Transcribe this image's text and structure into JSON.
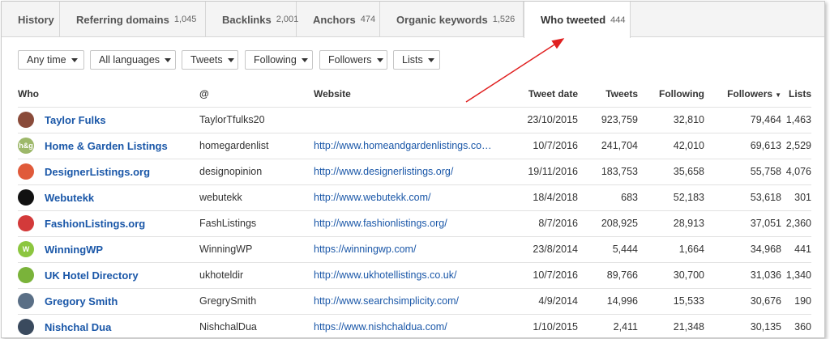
{
  "tabs": [
    {
      "label": "History",
      "count": ""
    },
    {
      "label": "Referring domains",
      "count": "1,045"
    },
    {
      "label": "Backlinks",
      "count": "2,001"
    },
    {
      "label": "Anchors",
      "count": "474"
    },
    {
      "label": "Organic keywords",
      "count": "1,526"
    },
    {
      "label": "Who tweeted",
      "count": "444"
    }
  ],
  "filters": [
    "Any time",
    "All languages",
    "Tweets",
    "Following",
    "Followers",
    "Lists"
  ],
  "table": {
    "headers": {
      "who": "Who",
      "at": "@",
      "website": "Website",
      "tweet_date": "Tweet date",
      "tweets": "Tweets",
      "following": "Following",
      "followers": "Followers",
      "lists": "Lists",
      "sort_indicator": "▼"
    },
    "rows": [
      {
        "name": "Taylor Fulks",
        "handle": "TaylorTfulks20",
        "website": "",
        "date": "23/10/2015",
        "tweets": "923,759",
        "following": "32,810",
        "followers": "79,464",
        "lists": "1,463",
        "avatar_color": "#8a4b3a",
        "avatar_text": ""
      },
      {
        "name": "Home & Garden Listings",
        "handle": "homegardenlist",
        "website": "http://www.homeandgardenlistings.co…",
        "date": "10/7/2016",
        "tweets": "241,704",
        "following": "42,010",
        "followers": "69,613",
        "lists": "2,529",
        "avatar_color": "#9db86a",
        "avatar_text": "h&g"
      },
      {
        "name": "DesignerListings.org",
        "handle": "designopinion",
        "website": "http://www.designerlistings.org/",
        "date": "19/11/2016",
        "tweets": "183,753",
        "following": "35,658",
        "followers": "55,758",
        "lists": "4,076",
        "avatar_color": "#e05a3a",
        "avatar_text": ""
      },
      {
        "name": "Webutekk",
        "handle": "webutekk",
        "website": "http://www.webutekk.com/",
        "date": "18/4/2018",
        "tweets": "683",
        "following": "52,183",
        "followers": "53,618",
        "lists": "301",
        "avatar_color": "#111111",
        "avatar_text": ""
      },
      {
        "name": "FashionListings.org",
        "handle": "FashListings",
        "website": "http://www.fashionlistings.org/",
        "date": "8/7/2016",
        "tweets": "208,925",
        "following": "28,913",
        "followers": "37,051",
        "lists": "2,360",
        "avatar_color": "#d33a3a",
        "avatar_text": ""
      },
      {
        "name": "WinningWP",
        "handle": "WinningWP",
        "website": "https://winningwp.com/",
        "date": "23/8/2014",
        "tweets": "5,444",
        "following": "1,664",
        "followers": "34,968",
        "lists": "441",
        "avatar_color": "#8cc63f",
        "avatar_text": "W"
      },
      {
        "name": "UK Hotel Directory",
        "handle": "ukhoteldir",
        "website": "http://www.ukhotellistings.co.uk/",
        "date": "10/7/2016",
        "tweets": "89,766",
        "following": "30,700",
        "followers": "31,036",
        "lists": "1,340",
        "avatar_color": "#7ab33a",
        "avatar_text": ""
      },
      {
        "name": "Gregory Smith",
        "handle": "GregrySmith",
        "website": "http://www.searchsimplicity.com/",
        "date": "4/9/2014",
        "tweets": "14,996",
        "following": "15,533",
        "followers": "30,676",
        "lists": "190",
        "avatar_color": "#5a6f86",
        "avatar_text": ""
      },
      {
        "name": "Nishchal Dua",
        "handle": "NishchalDua",
        "website": "https://www.nishchaldua.com/",
        "date": "1/10/2015",
        "tweets": "2,411",
        "following": "21,348",
        "followers": "30,135",
        "lists": "360",
        "avatar_color": "#3a4a5e",
        "avatar_text": ""
      }
    ]
  },
  "colors": {
    "link": "#1a57a8",
    "annotation_arrow": "#e02020"
  }
}
